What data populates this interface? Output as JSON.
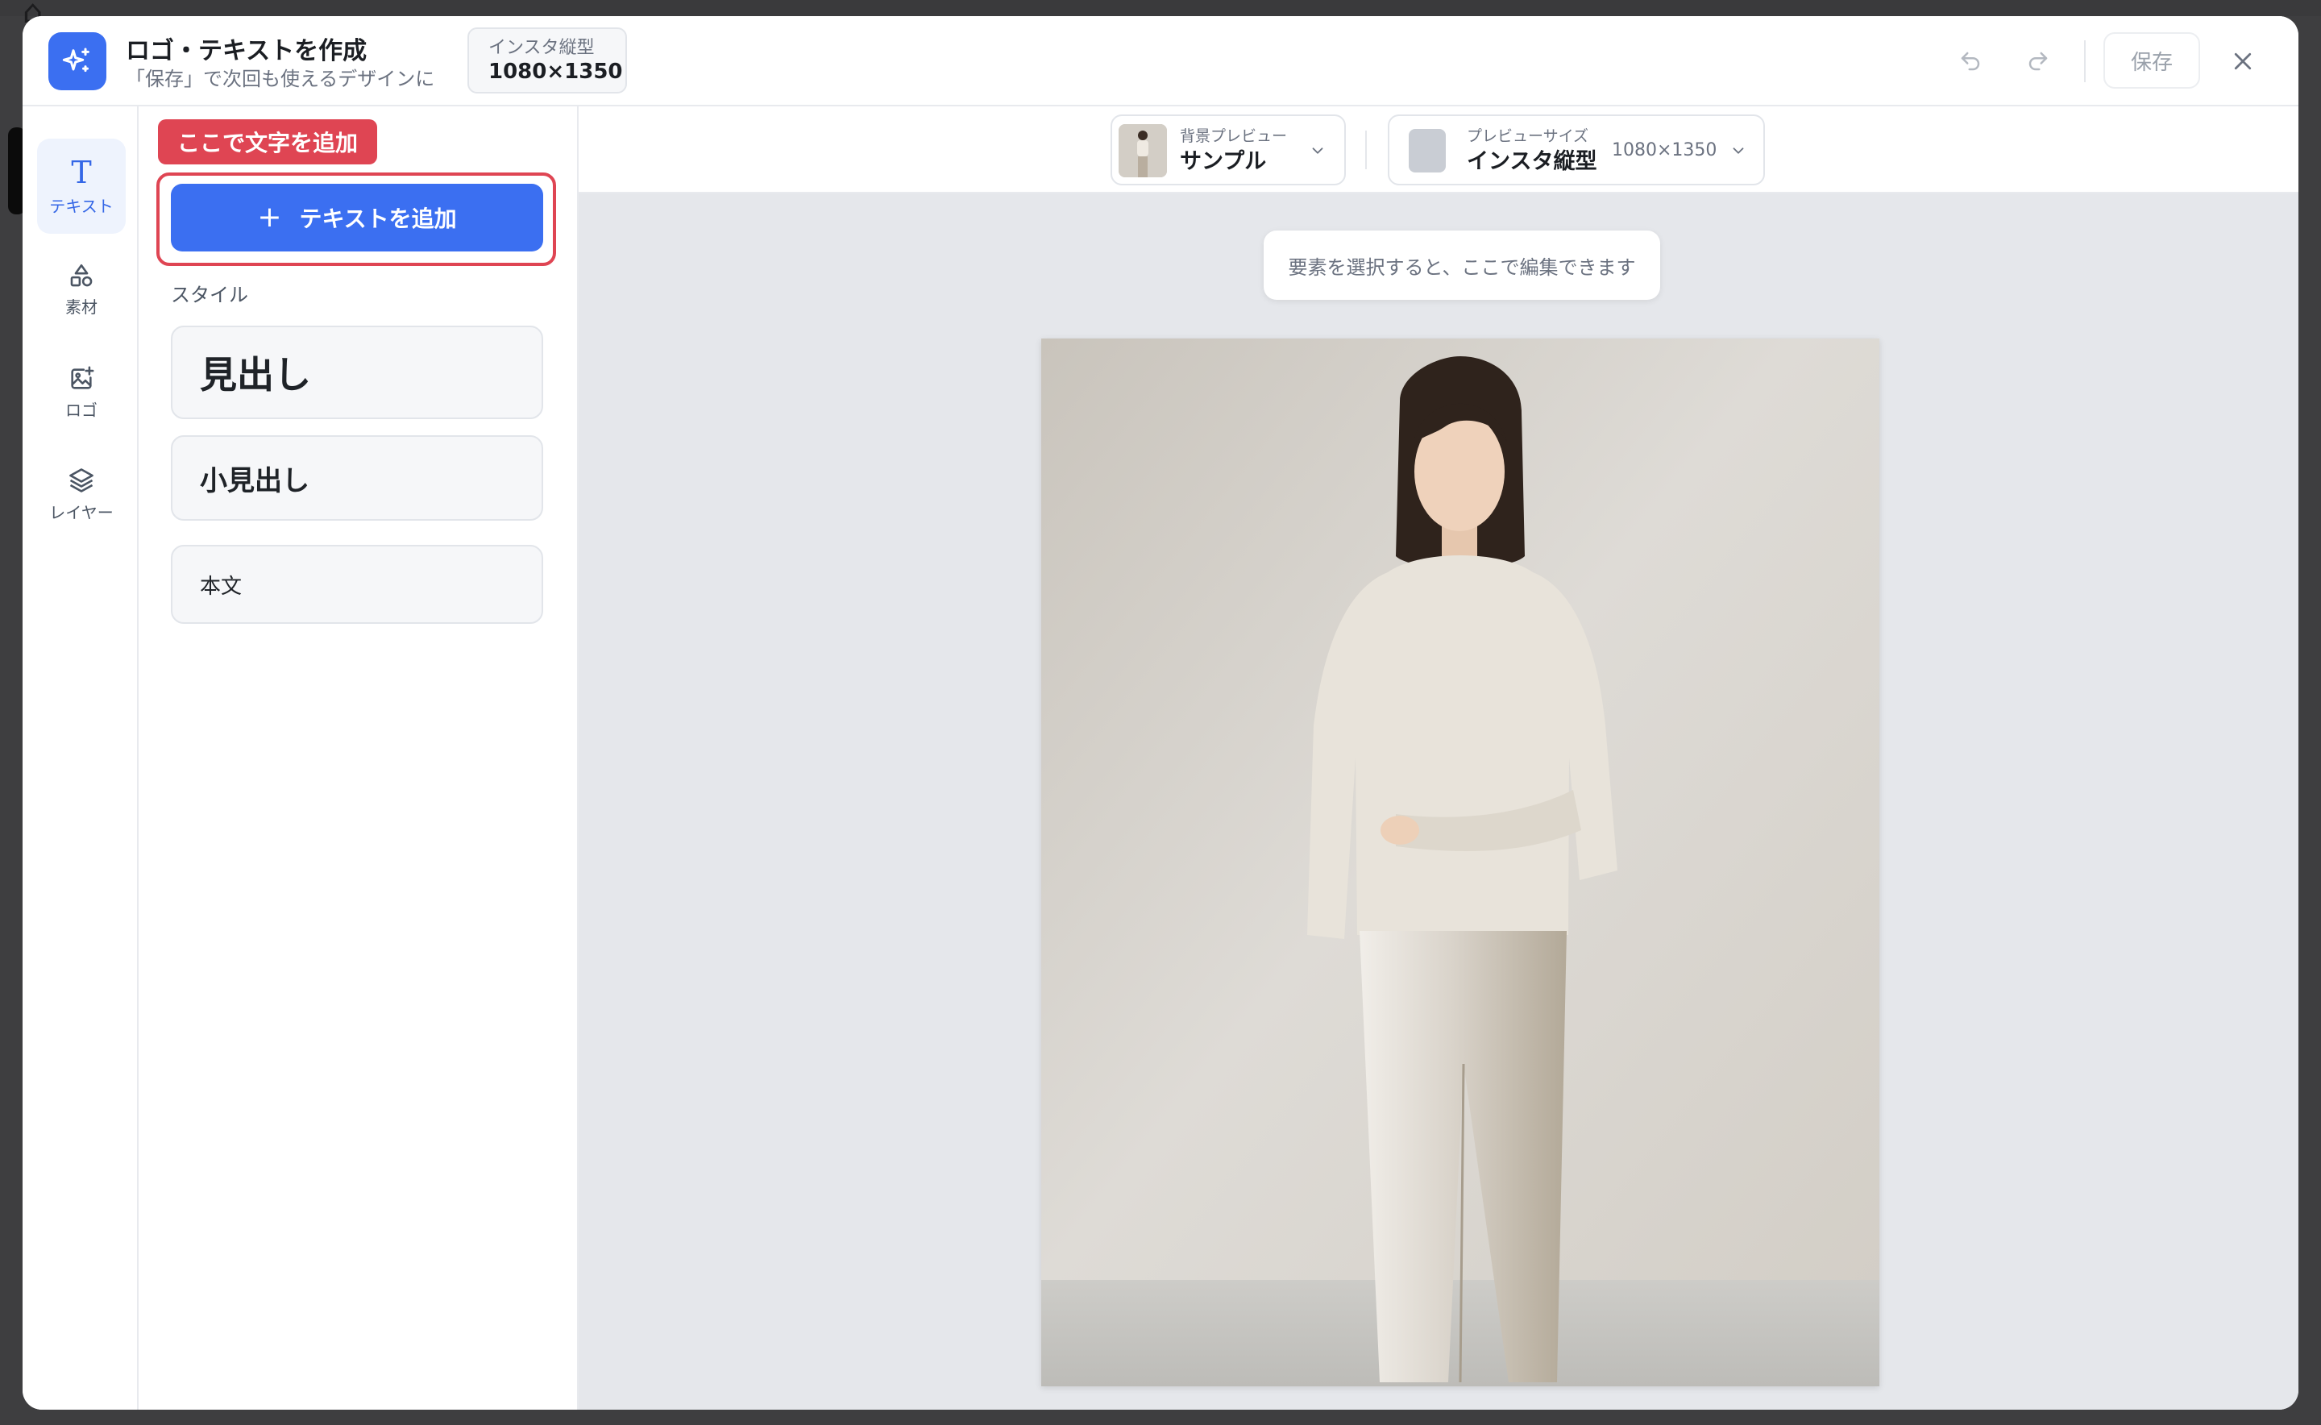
{
  "header": {
    "title": "ロゴ・テキストを作成",
    "subtitle": "「保存」で次回も使えるデザインに",
    "size_badge": {
      "label": "インスタ縦型",
      "value": "1080×1350"
    },
    "save_label": "保存",
    "icons": [
      "sparkle-icon",
      "undo-icon",
      "redo-icon",
      "close-icon"
    ]
  },
  "rail": {
    "items": [
      {
        "label": "テキスト",
        "icon": "text-icon",
        "active": true
      },
      {
        "label": "素材",
        "icon": "shapes-icon"
      },
      {
        "label": "ロゴ",
        "icon": "image-plus-icon"
      },
      {
        "label": "レイヤー",
        "icon": "layers-icon"
      }
    ]
  },
  "panel": {
    "callout": "ここで文字を追加",
    "add_text_label": "テキストを追加",
    "style_heading": "スタイル",
    "styles": [
      {
        "label": "見出し"
      },
      {
        "label": "小見出し"
      },
      {
        "label": "本文"
      }
    ]
  },
  "toolbar": {
    "bg_preview": {
      "caption": "背景プレビュー",
      "value": "サンプル"
    },
    "preview_size": {
      "caption": "プレビューサイズ",
      "value": "インスタ縦型",
      "dims": "1080×1350"
    }
  },
  "canvas": {
    "hint": "要素を選択すると、ここで編集できます"
  },
  "colors": {
    "accent": "#3b6ff1",
    "callout": "#df4553"
  }
}
